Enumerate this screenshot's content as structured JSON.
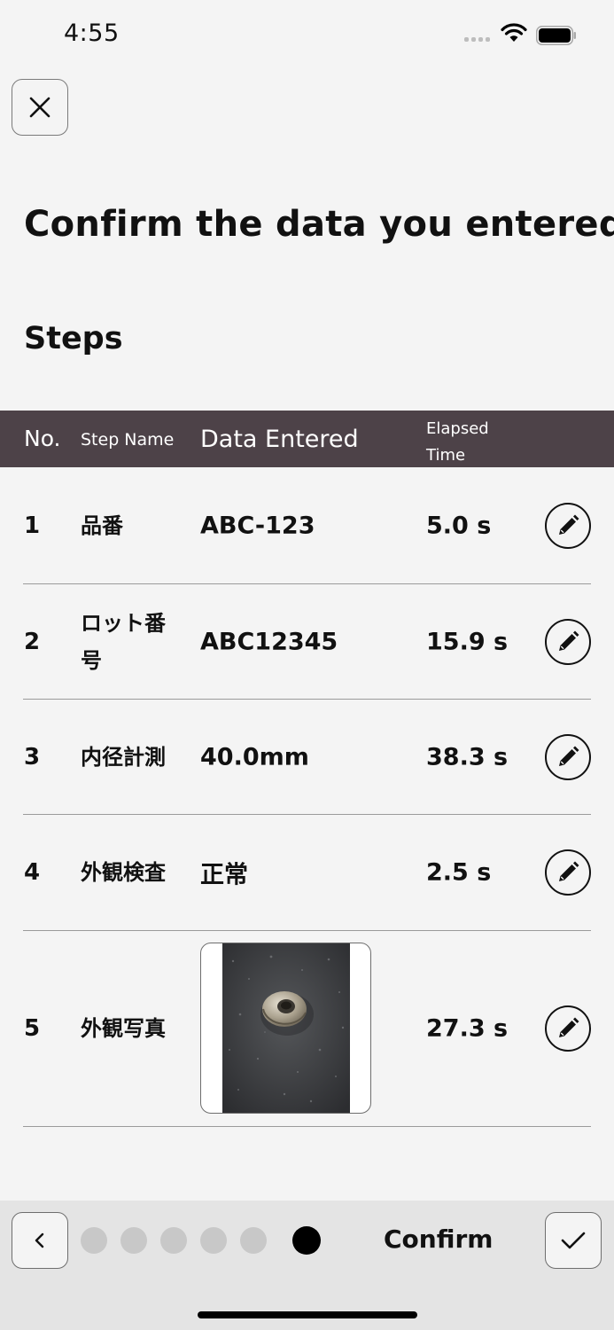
{
  "status_bar": {
    "time": "4:55"
  },
  "page": {
    "title": "Confirm the data you entered",
    "section": "Steps"
  },
  "table": {
    "headers": {
      "no": "No.",
      "step_name": "Step Name",
      "data_entered": "Data Entered",
      "elapsed_time": "Elapsed\nTime"
    },
    "rows": [
      {
        "no": "1",
        "step": "品番",
        "data": "ABC-123",
        "time": "5.0 s"
      },
      {
        "no": "2",
        "step": "ロット番号",
        "data": "ABC12345",
        "time": "15.9 s"
      },
      {
        "no": "3",
        "step": "内径計測",
        "data": "40.0mm",
        "time": "38.3 s"
      },
      {
        "no": "4",
        "step": "外観検査",
        "data": "正常",
        "time": "2.5 s"
      },
      {
        "no": "5",
        "step": "外観写真",
        "data": "",
        "time": "27.3 s"
      }
    ]
  },
  "footer": {
    "confirm_label": "Confirm",
    "progress": {
      "total": 6,
      "current": 6
    }
  },
  "colors": {
    "header_bg": "#4d4248",
    "background": "#f4f4f4",
    "footer_bg": "#e4e4e4"
  },
  "icons": {
    "close": "close-icon",
    "edit": "pencil-icon",
    "back": "chevron-left-icon",
    "confirm": "checkmark-icon"
  }
}
